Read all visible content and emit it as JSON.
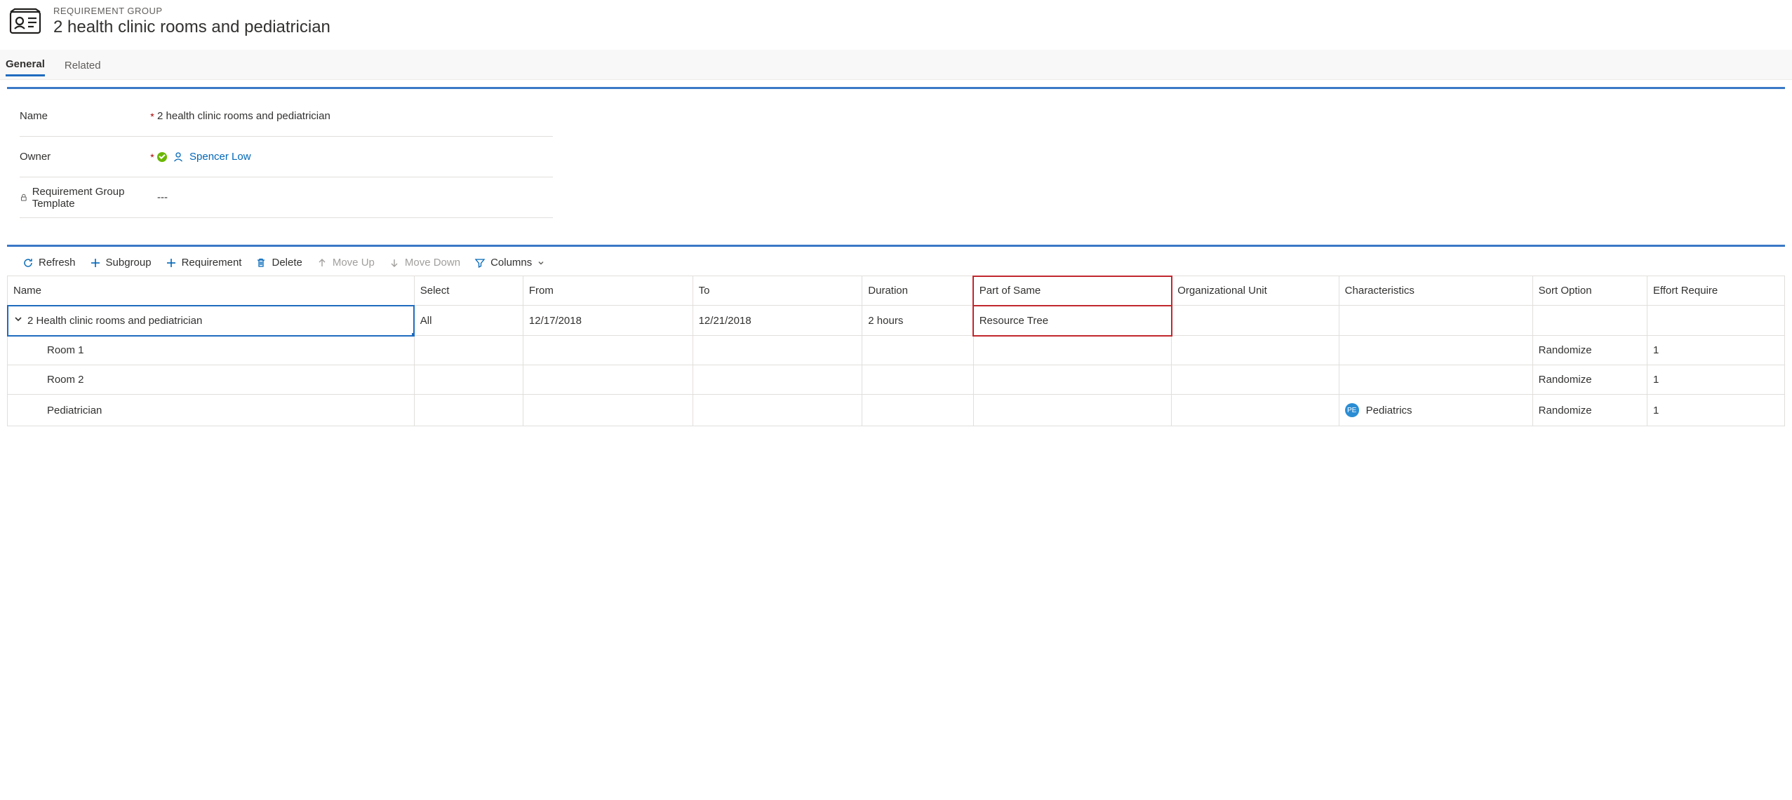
{
  "header": {
    "entity_type": "REQUIREMENT GROUP",
    "title": "2 health clinic rooms and pediatrician"
  },
  "tabs": {
    "general": "General",
    "related": "Related"
  },
  "form": {
    "name": {
      "label": "Name",
      "value": "2 health clinic rooms and pediatrician"
    },
    "owner": {
      "label": "Owner",
      "value": "Spencer Low"
    },
    "template": {
      "label": "Requirement Group Template",
      "value": "---"
    }
  },
  "toolbar": {
    "refresh": "Refresh",
    "subgroup": "Subgroup",
    "requirement": "Requirement",
    "delete": "Delete",
    "moveup": "Move Up",
    "movedown": "Move Down",
    "columns": "Columns"
  },
  "grid": {
    "headers": {
      "name": "Name",
      "select": "Select",
      "from": "From",
      "to": "To",
      "duration": "Duration",
      "partofsame": "Part of Same",
      "orgunit": "Organizational Unit",
      "characteristics": "Characteristics",
      "sort": "Sort Option",
      "effort": "Effort Require"
    },
    "rows": [
      {
        "name": "2 Health clinic rooms and pediatrician",
        "select": "All",
        "from": "12/17/2018",
        "to": "12/21/2018",
        "duration": "2 hours",
        "partofsame": "Resource Tree",
        "orgunit": "",
        "char_badge": "",
        "char_text": "",
        "sort": "",
        "effort": "",
        "level": 0,
        "expanded": true
      },
      {
        "name": "Room 1",
        "select": "",
        "from": "",
        "to": "",
        "duration": "",
        "partofsame": "",
        "orgunit": "",
        "char_badge": "",
        "char_text": "",
        "sort": "Randomize",
        "effort": "1",
        "level": 1
      },
      {
        "name": "Room 2",
        "select": "",
        "from": "",
        "to": "",
        "duration": "",
        "partofsame": "",
        "orgunit": "",
        "char_badge": "",
        "char_text": "",
        "sort": "Randomize",
        "effort": "1",
        "level": 1
      },
      {
        "name": "Pediatrician",
        "select": "",
        "from": "",
        "to": "",
        "duration": "",
        "partofsame": "",
        "orgunit": "",
        "char_badge": "PE",
        "char_text": "Pediatrics",
        "sort": "Randomize",
        "effort": "1",
        "level": 1
      }
    ]
  }
}
